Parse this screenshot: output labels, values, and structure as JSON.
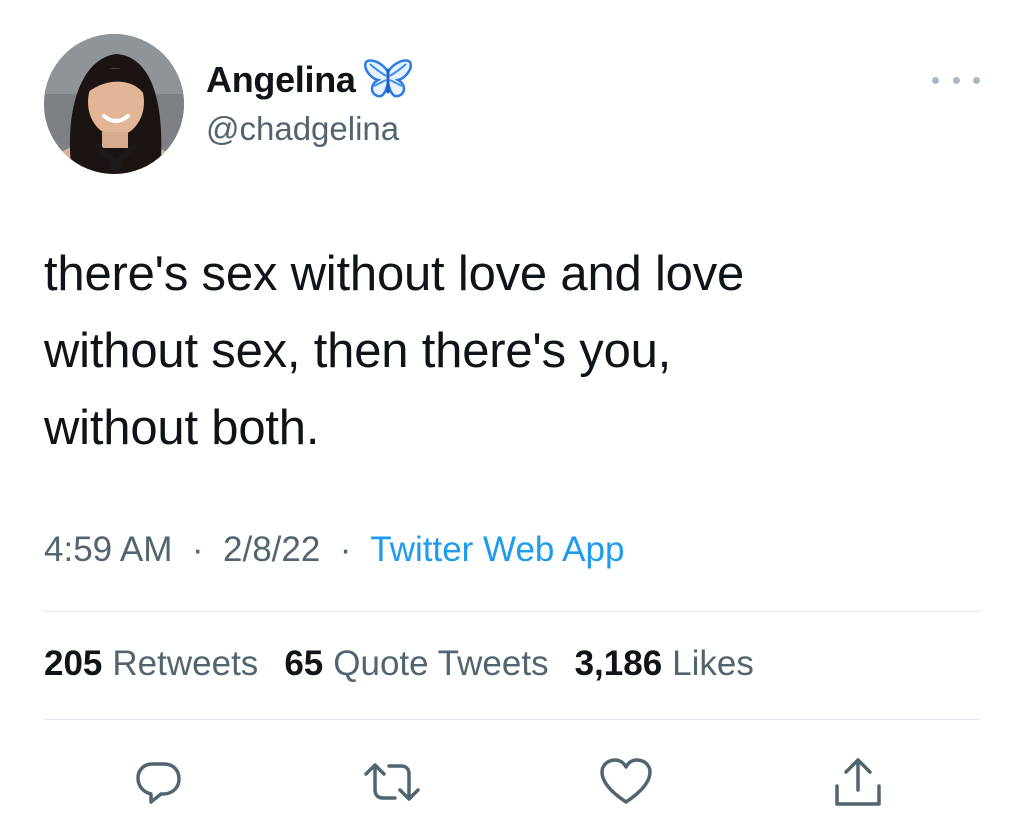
{
  "author": {
    "display_name": "Angelina",
    "handle": "@chadgelina",
    "avatar_icon": "avatar",
    "badge_icon": "butterfly-icon"
  },
  "tweet": {
    "text": "there's sex without love and love without sex, then there's you, without both.",
    "lines": [
      "there's sex without love and love",
      "without sex, then there's you,",
      "without both."
    ],
    "time": "4:59 AM",
    "separator": "·",
    "date": "2/8/22",
    "source": "Twitter Web App"
  },
  "stats": {
    "retweets": {
      "count": "205",
      "label": "Retweets"
    },
    "quotes": {
      "count": "65",
      "label": "Quote Tweets"
    },
    "likes": {
      "count": "3,186",
      "label": "Likes"
    }
  },
  "actions": [
    {
      "name": "reply",
      "icon": "reply-icon"
    },
    {
      "name": "retweet",
      "icon": "retweet-icon"
    },
    {
      "name": "like",
      "icon": "heart-icon"
    },
    {
      "name": "share",
      "icon": "share-icon"
    }
  ],
  "colors": {
    "text": "#0f1419",
    "secondary": "#536471",
    "link": "#1d9bf0",
    "divider": "#e1e8ed",
    "butterfly": "#3b8ff0"
  }
}
